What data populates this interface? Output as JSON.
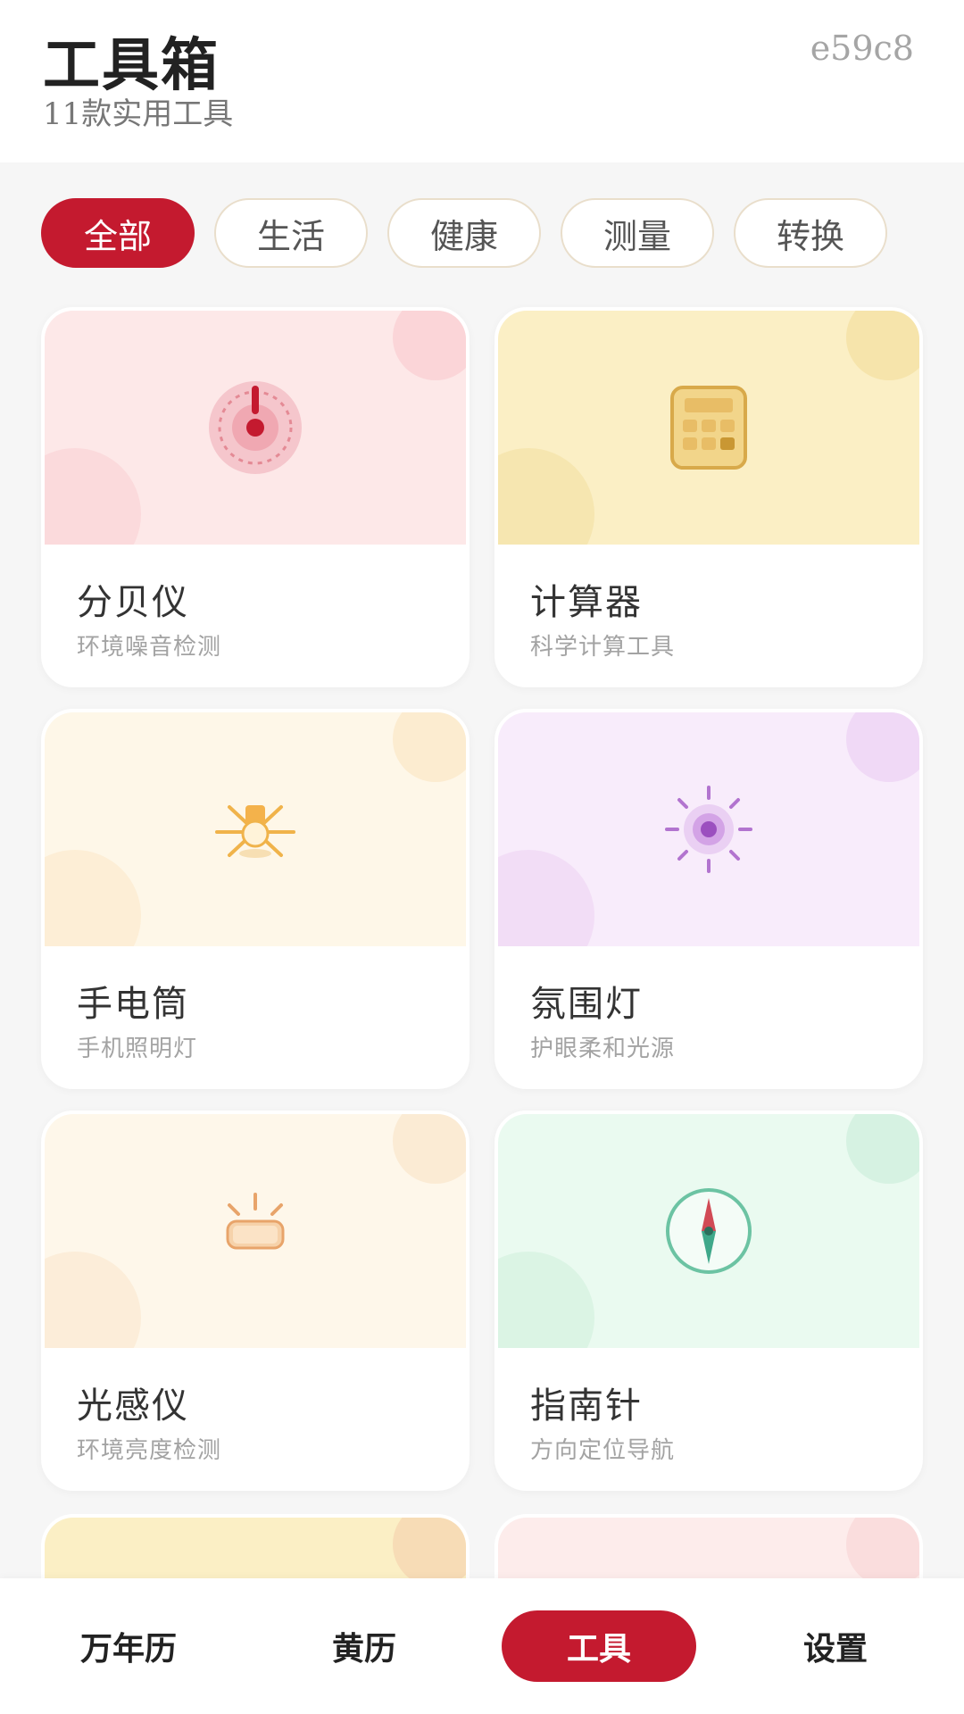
{
  "header": {
    "title": "工具箱",
    "subtitle": "11款实用工具",
    "code": "e59c8"
  },
  "filters": [
    {
      "label": "全部",
      "active": true
    },
    {
      "label": "生活",
      "active": false
    },
    {
      "label": "健康",
      "active": false
    },
    {
      "label": "测量",
      "active": false
    },
    {
      "label": "转换",
      "active": false
    }
  ],
  "tools": [
    {
      "name": "分贝仪",
      "desc": "环境噪音检测",
      "icon": "decibel-icon",
      "bg": "#fde8e8",
      "blob": "#f9cdd2"
    },
    {
      "name": "计算器",
      "desc": "科学计算工具",
      "icon": "calculator-icon",
      "bg": "#fbefc5",
      "blob": "#f3df9f"
    },
    {
      "name": "手电筒",
      "desc": "手机照明灯",
      "icon": "flashlight-icon",
      "bg": "#fef7e8",
      "blob": "#fbe7c6"
    },
    {
      "name": "氛围灯",
      "desc": "护眼柔和光源",
      "icon": "ambient-light-icon",
      "bg": "#f8ecfb",
      "blob": "#ecd2f3"
    },
    {
      "name": "光感仪",
      "desc": "环境亮度检测",
      "icon": "lux-meter-icon",
      "bg": "#fef7ea",
      "blob": "#f9e6cb"
    },
    {
      "name": "指南针",
      "desc": "方向定位导航",
      "icon": "compass-icon",
      "bg": "#eafaf0",
      "blob": "#cdeedb"
    }
  ],
  "partial_cards": [
    {
      "bg": "#fbefc5",
      "blob": "#f6d7b2"
    },
    {
      "bg": "#fdeceb",
      "blob": "#f9dada"
    }
  ],
  "tabbar": [
    {
      "label": "万年历",
      "active": false
    },
    {
      "label": "黄历",
      "active": false
    },
    {
      "label": "工具",
      "active": true
    },
    {
      "label": "设置",
      "active": false
    }
  ],
  "colors": {
    "accent": "#c41a2f"
  }
}
